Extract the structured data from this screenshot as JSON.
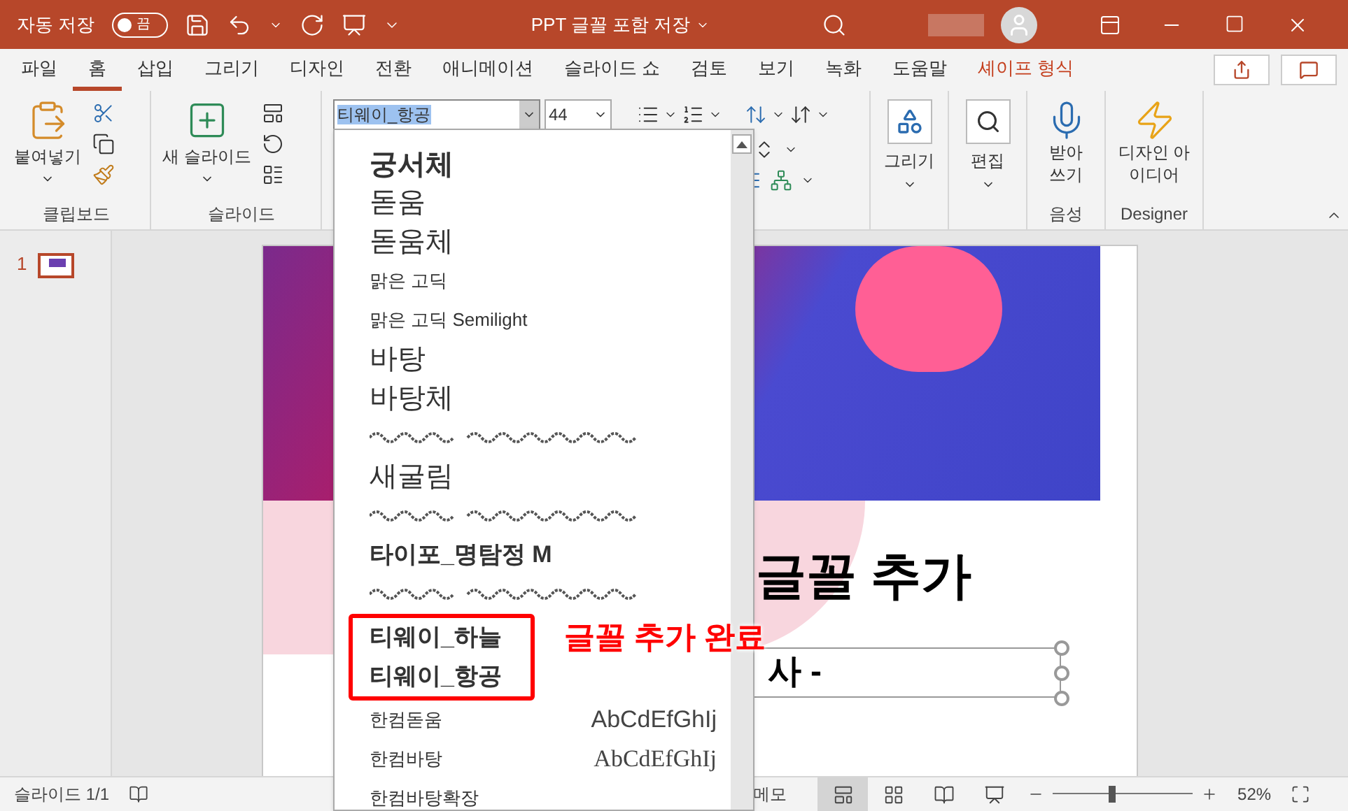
{
  "title_bar": {
    "autosave_label": "자동 저장",
    "autosave_toggle": {
      "on": false,
      "label": "끔"
    },
    "title": "PPT 글꼴 포함 저장"
  },
  "tabs": [
    {
      "label": "파일",
      "selected": false,
      "kind": "normal"
    },
    {
      "label": "홈",
      "selected": true,
      "kind": "normal"
    },
    {
      "label": "삽입",
      "selected": false,
      "kind": "normal"
    },
    {
      "label": "그리기",
      "selected": false,
      "kind": "normal"
    },
    {
      "label": "디자인",
      "selected": false,
      "kind": "normal"
    },
    {
      "label": "전환",
      "selected": false,
      "kind": "normal"
    },
    {
      "label": "애니메이션",
      "selected": false,
      "kind": "normal"
    },
    {
      "label": "슬라이드 쇼",
      "selected": false,
      "kind": "normal"
    },
    {
      "label": "검토",
      "selected": false,
      "kind": "normal"
    },
    {
      "label": "보기",
      "selected": false,
      "kind": "normal"
    },
    {
      "label": "녹화",
      "selected": false,
      "kind": "normal"
    },
    {
      "label": "도움말",
      "selected": false,
      "kind": "normal"
    },
    {
      "label": "셰이프 형식",
      "selected": false,
      "kind": "contextual"
    }
  ],
  "ribbon": {
    "clipboard": {
      "paste": "붙여넣기",
      "label": "클립보드"
    },
    "slides": {
      "new_slide": "새 슬라이드",
      "label": "슬라이드"
    },
    "font": {
      "name": "티웨이_항공",
      "name_selected": true,
      "size": "44"
    },
    "drawing": {
      "label": "그리기"
    },
    "editing": {
      "label": "편집"
    },
    "voice": {
      "dictate": "받아 쓰기",
      "label": "음성"
    },
    "designer": {
      "button": "디자인 아이디어",
      "label": "Designer"
    }
  },
  "thumbnails": [
    {
      "number": "1",
      "selected": true
    }
  ],
  "slide": {
    "title": "글꼴 추가",
    "subtitle": "사 -"
  },
  "font_list": {
    "items": [
      {
        "kind": "display",
        "name": "궁서체",
        "highlighted": false
      },
      {
        "kind": "large",
        "name": "돋움",
        "highlighted": false
      },
      {
        "kind": "large",
        "name": "돋움체",
        "highlighted": false
      },
      {
        "kind": "small",
        "name": "맑은 고딕",
        "highlighted": false
      },
      {
        "kind": "small",
        "name": "맑은 고딕 Semilight",
        "highlighted": false
      },
      {
        "kind": "large",
        "name": "바탕",
        "highlighted": false
      },
      {
        "kind": "large",
        "name": "바탕체",
        "highlighted": false
      },
      {
        "kind": "symbol",
        "highlighted": false
      },
      {
        "kind": "large",
        "name": "새굴림",
        "highlighted": false
      },
      {
        "kind": "symbol",
        "highlighted": false
      },
      {
        "kind": "bold",
        "name": "타이포_명탐정 M",
        "highlighted": false
      },
      {
        "kind": "symbol",
        "highlighted": false
      },
      {
        "kind": "bold",
        "name": "티웨이_하늘",
        "highlighted": true
      },
      {
        "kind": "bold",
        "name": "티웨이_항공",
        "highlighted": true
      },
      {
        "kind": "sample-sans",
        "name": "한컴돋움",
        "preview": "AbCdEfGhIj",
        "highlighted": false
      },
      {
        "kind": "sample-serif",
        "name": "한컴바탕",
        "preview": "AbCdEfGhIj",
        "highlighted": false
      },
      {
        "kind": "small",
        "name": "한컴바탕확장",
        "highlighted": false
      }
    ]
  },
  "annotation": "글꼴 추가 완료",
  "status_bar": {
    "slide_count": "슬라이드 1/1",
    "notes": "메모",
    "views": [
      {
        "kind": "normal",
        "selected": true
      },
      {
        "kind": "sorter",
        "selected": false
      },
      {
        "kind": "reading",
        "selected": false
      },
      {
        "kind": "slideshow",
        "selected": false
      }
    ],
    "zoom": {
      "level": 0.42,
      "reading": "52%"
    }
  }
}
